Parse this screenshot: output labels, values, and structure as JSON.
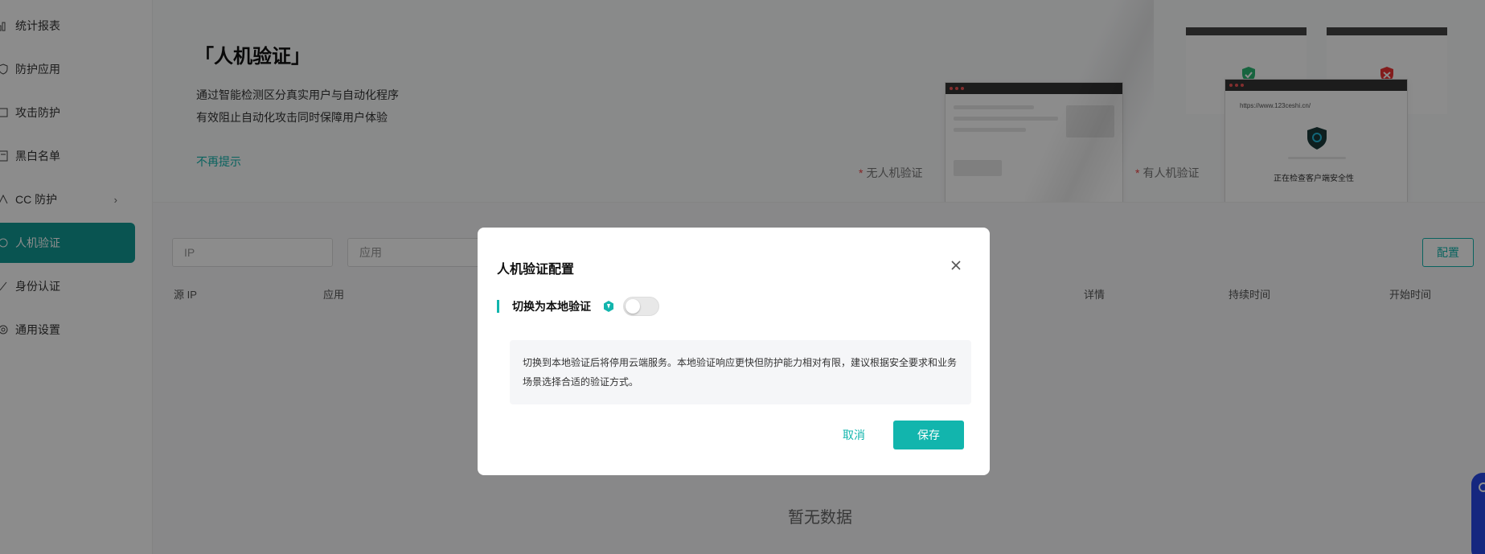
{
  "sidebar": {
    "items": [
      {
        "label": "统计报表",
        "icon": "bar-chart-icon"
      },
      {
        "label": "防护应用",
        "icon": "shield-icon"
      },
      {
        "label": "攻击防护",
        "icon": "attack-icon"
      },
      {
        "label": "黑白名单",
        "icon": "list-icon"
      },
      {
        "label": "CC 防护",
        "icon": "cc-icon"
      },
      {
        "label": "人机验证",
        "icon": "captcha-icon"
      },
      {
        "label": "身份认证",
        "icon": "identity-icon"
      },
      {
        "label": "通用设置",
        "icon": "settings-icon"
      }
    ],
    "active_index": 5
  },
  "banner": {
    "title": "「人机验证」",
    "desc_line1": "通过智能检测区分真实用户与自动化程序",
    "desc_line2": "有效阻止自动化攻击同时保障用户体验",
    "dismiss": "不再提示",
    "caption_left": "无人机验证",
    "caption_right": "有人机验证",
    "mock_url": "https://www.123ceshi.cn/",
    "mock_checking": "正在检查客户端安全性"
  },
  "toolbar": {
    "ip_placeholder": "IP",
    "app_placeholder": "应用",
    "config_label": "配置"
  },
  "table": {
    "headers": [
      "源 IP",
      "应用",
      "详情",
      "持续时间",
      "开始时间"
    ],
    "empty_text": "暂无数据"
  },
  "modal": {
    "title": "人机验证配置",
    "toggle_label": "切换为本地验证",
    "toggle_on": false,
    "notice": "切换到本地验证后将停用云端服务。本地验证响应更快但防护能力相对有限，建议根据安全要求和业务场景选择合适的验证方式。",
    "cancel": "取消",
    "save": "保存"
  },
  "colors": {
    "accent": "#12b5ad",
    "active_nav": "#119a94",
    "float_tab": "#2747e8"
  }
}
